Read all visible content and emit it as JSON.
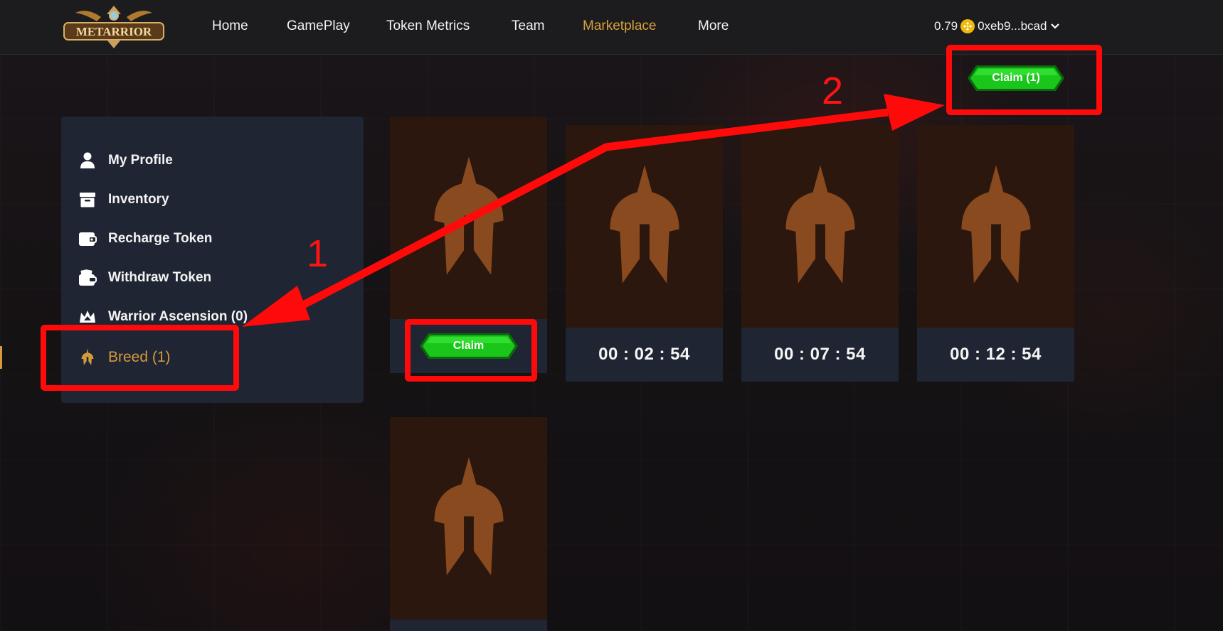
{
  "header": {
    "logo_text": "METARRIOR",
    "nav": [
      {
        "label": "Home",
        "active": false
      },
      {
        "label": "GamePlay",
        "active": false
      },
      {
        "label": "Token Metrics",
        "active": false
      },
      {
        "label": "Team",
        "active": false
      },
      {
        "label": "Marketplace",
        "active": true
      },
      {
        "label": "More",
        "active": false
      }
    ],
    "balance": "0.79",
    "coin_icon": "bnb-coin-icon",
    "address": "0xeb9...bcad"
  },
  "claim_all": {
    "label": "Claim (1)"
  },
  "sidebar": {
    "items": [
      {
        "label": "My Profile",
        "icon": "user-icon"
      },
      {
        "label": "Inventory",
        "icon": "archive-box-icon"
      },
      {
        "label": "Recharge Token",
        "icon": "wallet-icon"
      },
      {
        "label": "Withdraw Token",
        "icon": "wallet-cards-icon"
      },
      {
        "label": "Warrior Ascension (0)",
        "icon": "crown-icon"
      },
      {
        "label": "Breed (1)",
        "icon": "helmet-icon",
        "active": true
      }
    ]
  },
  "eggs": [
    {
      "status": "ready",
      "claim_label": "Claim"
    },
    {
      "status": "hatching",
      "timer": "00 : 02 : 54"
    },
    {
      "status": "hatching",
      "timer": "00 : 07 : 54"
    },
    {
      "status": "hatching",
      "timer": "00 : 12 : 54"
    },
    {
      "status": "unknown"
    }
  ],
  "annotations": {
    "step1": "1",
    "step2": "2"
  },
  "colors": {
    "accent": "#d49a3c",
    "claim_green": "#1ed61e",
    "annotation_red": "#ff0a0a",
    "helmet": "#8a4a1f"
  }
}
